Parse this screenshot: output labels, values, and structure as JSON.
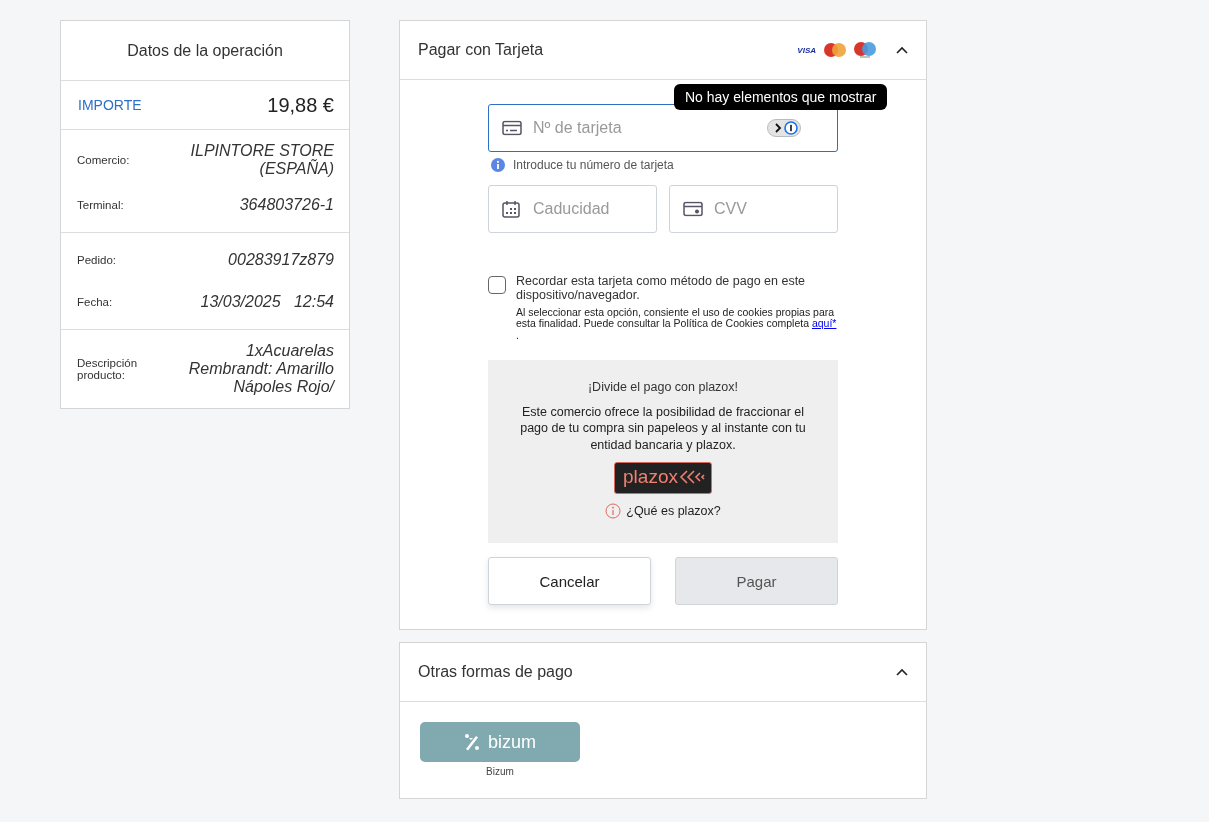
{
  "details": {
    "title": "Datos de la operación",
    "amount_label": "IMPORTE",
    "amount": "19,88 €",
    "groups": [
      [
        {
          "label": "Comercio:",
          "value": "ILPINTORE STORE (ESPAÑA)"
        },
        {
          "label": "Terminal:",
          "value": "364803726-1"
        }
      ],
      [
        {
          "label": "Pedido:",
          "value": "00283917z879"
        },
        {
          "label": "Fecha:",
          "value": "13/03/2025   12:54"
        }
      ],
      [
        {
          "label": "Descripción producto:",
          "value": "1xAcuarelas Rembrandt: Amarillo Nápoles Rojo/"
        }
      ]
    ]
  },
  "card_payment": {
    "title": "Pagar con Tarjeta",
    "expanded": true,
    "visa_text": "VISA",
    "card_number": {
      "placeholder": "Nº de tarjeta",
      "focused": true,
      "hint": "Introduce tu número de tarjeta",
      "tooltip": "No hay elementos que mostrar"
    },
    "expiry": {
      "placeholder": "Caducidad",
      "focused": false
    },
    "cvv": {
      "placeholder": "CVV",
      "focused": false
    },
    "remember": {
      "label": "Recordar esta tarjeta como método de pago en este dispositivo/navegador.",
      "checked": false,
      "note": "Al seleccionar esta opción, consiente el uso de cookies propias para esta finalidad. Puede consultar la Política de Cookies completa",
      "link": "aquí*",
      "note_end": "."
    },
    "plazox": {
      "title": "¡Divide el pago con plazox!",
      "text": "Este comercio ofrece la posibilidad de fraccionar el pago de tu compra sin papeleos y al instante con tu entidad bancaria y plazox.",
      "logo_text": "plazox",
      "link": "¿Qué es plazox?"
    },
    "buttons": [
      {
        "label": "Cancelar",
        "disabled": false
      },
      {
        "label": "Pagar",
        "disabled": true
      }
    ]
  },
  "other_payment": {
    "title": "Otras formas de pago",
    "expanded": true,
    "methods": [
      {
        "logo_text": "bizum",
        "label": "Bizum"
      }
    ]
  }
}
